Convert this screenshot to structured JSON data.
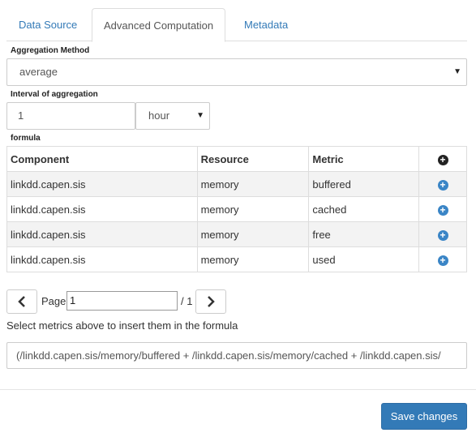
{
  "tabs": [
    {
      "label": "Data Source"
    },
    {
      "label": "Advanced Computation"
    },
    {
      "label": "Metadata"
    }
  ],
  "aggregation": {
    "label": "Aggregation Method",
    "value": "average"
  },
  "interval": {
    "label": "Interval of aggregation",
    "value": "1",
    "unit": "hour"
  },
  "formula_table": {
    "label": "formula",
    "headers": [
      "Component",
      "Resource",
      "Metric"
    ],
    "rows": [
      {
        "component": "linkdd.capen.sis",
        "resource": "memory",
        "metric": "buffered"
      },
      {
        "component": "linkdd.capen.sis",
        "resource": "memory",
        "metric": "cached"
      },
      {
        "component": "linkdd.capen.sis",
        "resource": "memory",
        "metric": "free"
      },
      {
        "component": "linkdd.capen.sis",
        "resource": "memory",
        "metric": "used"
      }
    ]
  },
  "pager": {
    "page_label": "Page",
    "page_value": "1",
    "total": "/ 1"
  },
  "hint": "Select metrics above to insert them in the formula",
  "formula": {
    "value": "(/linkdd.capen.sis/memory/buffered + /linkdd.capen.sis/memory/cached + /linkdd.capen.sis/"
  },
  "footer": {
    "save_label": "Save changes"
  },
  "colors": {
    "accent": "#337ab7",
    "add_icon": "#3a85c6",
    "zebra": "#f3f3f3"
  }
}
